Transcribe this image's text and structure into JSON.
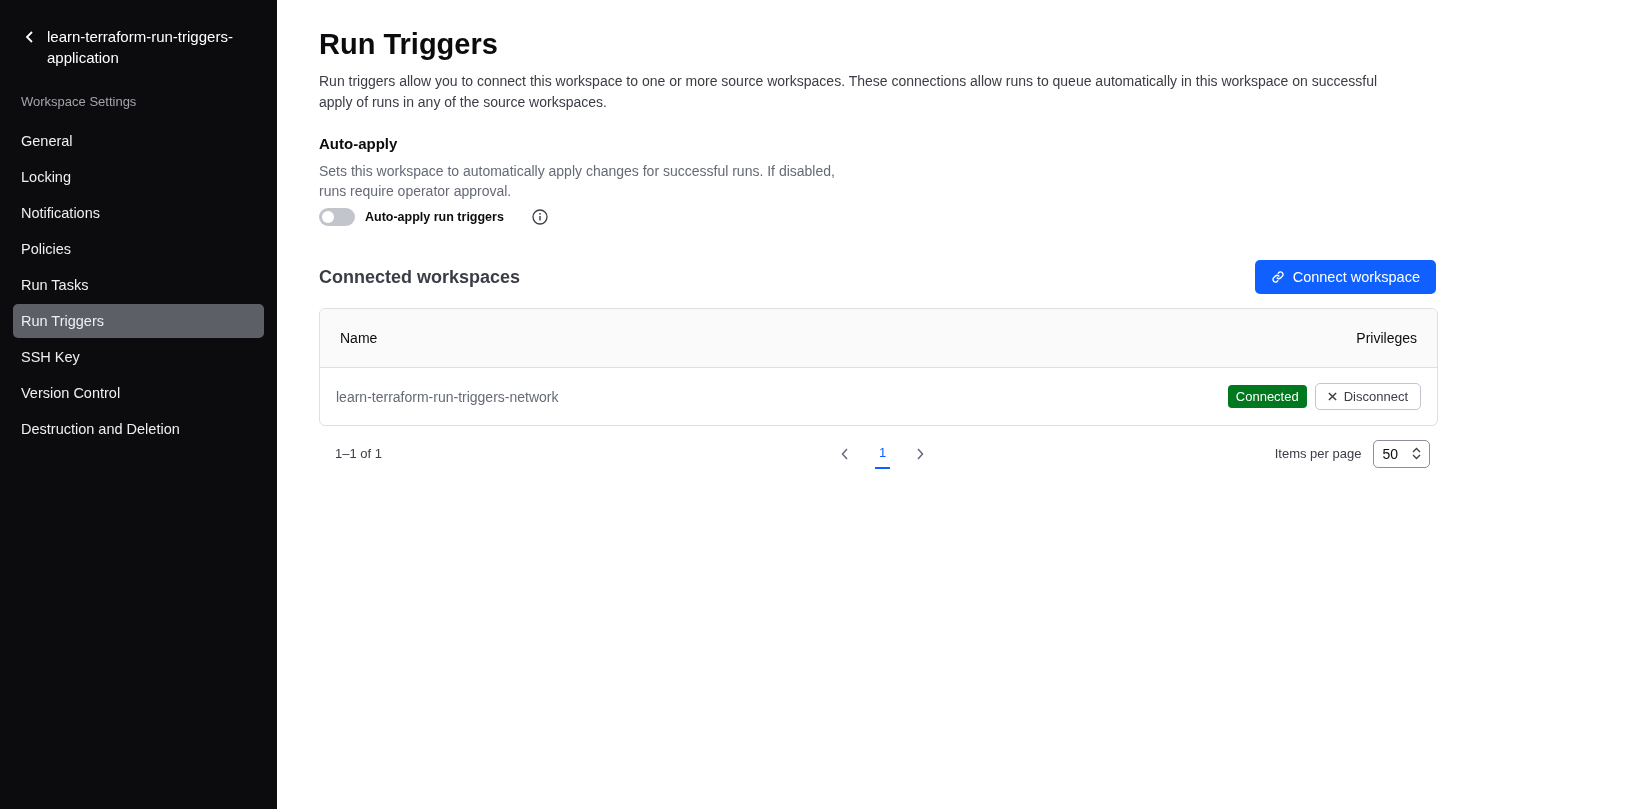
{
  "sidebar": {
    "back_title": "learn-terraform-run-triggers-application",
    "section": "Workspace Settings",
    "items": [
      {
        "label": "General",
        "selected": false
      },
      {
        "label": "Locking",
        "selected": false
      },
      {
        "label": "Notifications",
        "selected": false
      },
      {
        "label": "Policies",
        "selected": false
      },
      {
        "label": "Run Tasks",
        "selected": false
      },
      {
        "label": "Run Triggers",
        "selected": true
      },
      {
        "label": "SSH Key",
        "selected": false
      },
      {
        "label": "Version Control",
        "selected": false
      },
      {
        "label": "Destruction and Deletion",
        "selected": false
      }
    ]
  },
  "page": {
    "title": "Run Triggers",
    "description": "Run triggers allow you to connect this workspace to one or more source workspaces. These connections allow runs to queue automatically in this workspace on successful apply of runs in any of the source workspaces.",
    "auto_apply": {
      "heading": "Auto-apply",
      "description": "Sets this workspace to automatically apply changes for successful runs. If disabled, runs require operator approval.",
      "toggle": {
        "label": "Auto-apply run triggers",
        "on": false
      }
    },
    "connected": {
      "heading": "Connected workspaces",
      "button": "Connect workspace",
      "table": {
        "columns": [
          "Name",
          "Privileges"
        ],
        "rows": [
          {
            "name": "learn-terraform-run-triggers-network",
            "status": "Connected",
            "action": "Disconnect"
          }
        ]
      },
      "pagination": {
        "range": "1–1 of 1",
        "pages": [
          {
            "label": "1",
            "selected": true
          }
        ],
        "per_page_label": "Items per page",
        "per_page": "50"
      }
    }
  }
}
